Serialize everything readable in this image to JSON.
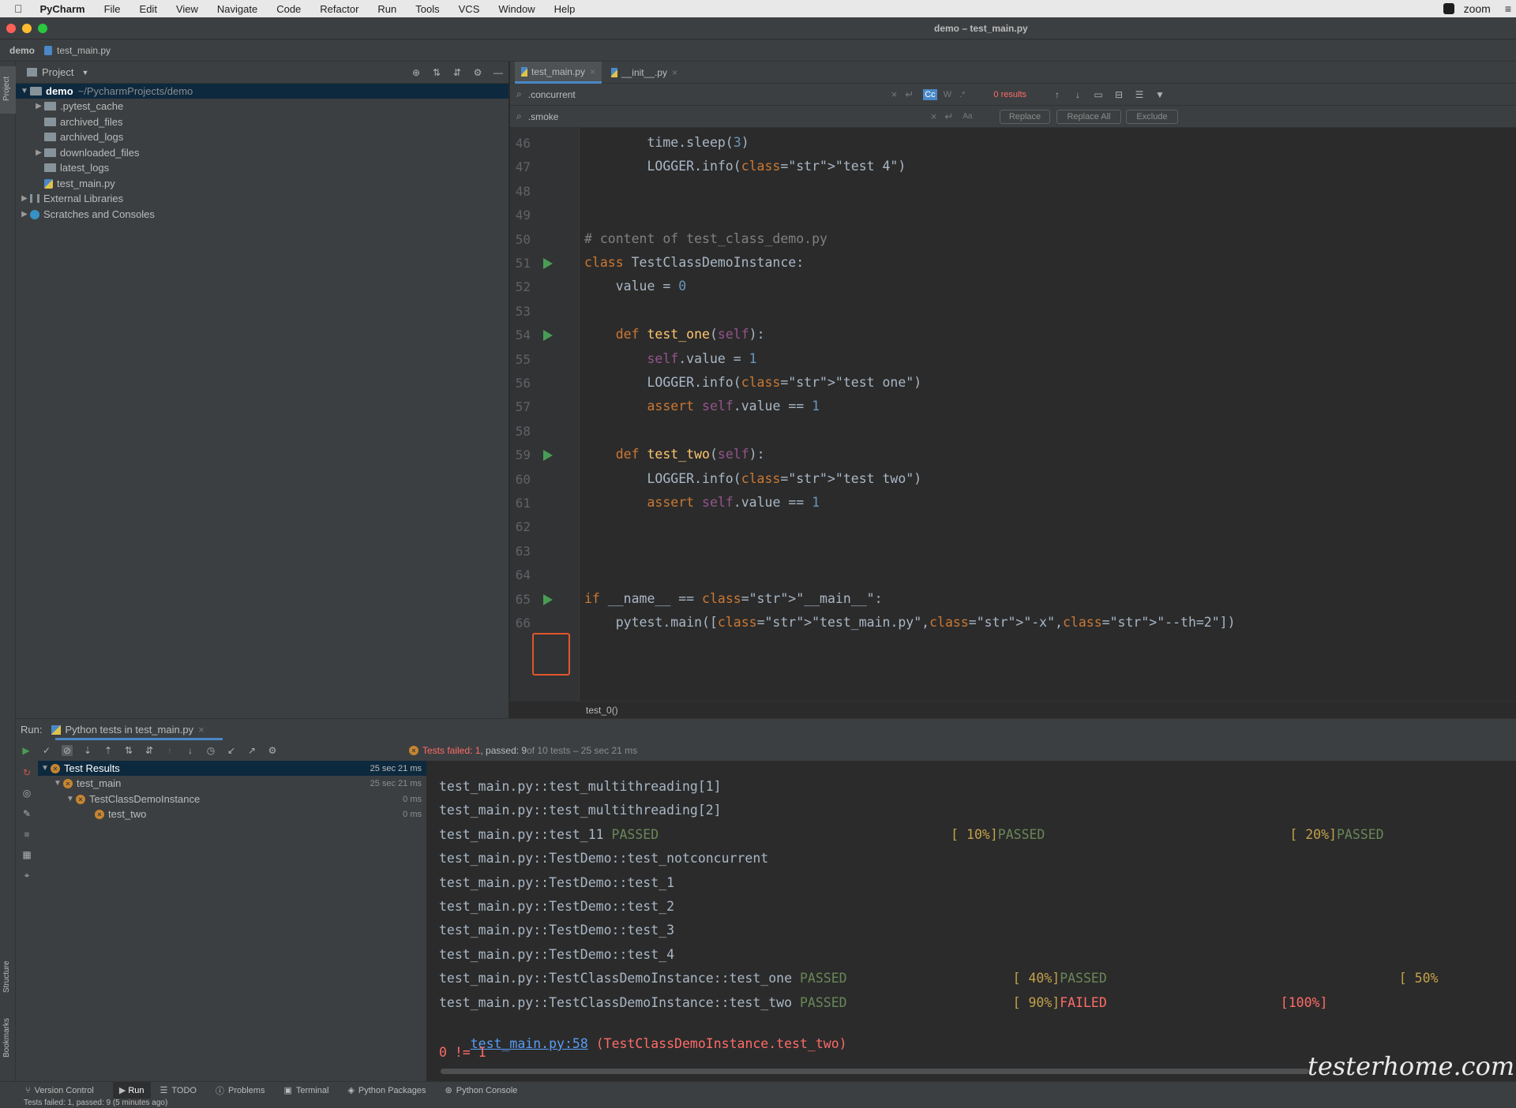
{
  "menubar": {
    "app": "PyCharm",
    "items": [
      "File",
      "Edit",
      "View",
      "Navigate",
      "Code",
      "Refactor",
      "Run",
      "Tools",
      "VCS",
      "Window",
      "Help"
    ],
    "right": "zoom"
  },
  "window": {
    "title": "demo – test_main.py"
  },
  "nav": {
    "project": "demo",
    "file": "test_main.py"
  },
  "project_panel": {
    "title": "Project",
    "tree": [
      {
        "label": "demo",
        "extra": "~/PycharmProjects/demo",
        "depth": 0,
        "type": "folder",
        "expanded": true,
        "selected": true
      },
      {
        "label": ".pytest_cache",
        "depth": 1,
        "type": "folder",
        "collapsed": true
      },
      {
        "label": "archived_files",
        "depth": 1,
        "type": "folder"
      },
      {
        "label": "archived_logs",
        "depth": 1,
        "type": "folder"
      },
      {
        "label": "downloaded_files",
        "depth": 1,
        "type": "folder",
        "collapsed": true
      },
      {
        "label": "latest_logs",
        "depth": 1,
        "type": "folder"
      },
      {
        "label": "test_main.py",
        "depth": 1,
        "type": "python-file"
      },
      {
        "label": "External Libraries",
        "depth": 0,
        "type": "library",
        "collapsed": true
      },
      {
        "label": "Scratches and Consoles",
        "depth": 0,
        "type": "scratch",
        "collapsed": true
      }
    ]
  },
  "editor": {
    "tabs": [
      {
        "label": "test_main.py",
        "active": true
      },
      {
        "label": "__init__.py",
        "active": false
      }
    ],
    "find": {
      "query": ".concurrent",
      "results": "0 results",
      "cc": "Cc",
      "w": "W"
    },
    "replace": {
      "query": ".smoke",
      "replace_label": "Replace",
      "replace_all_label": "Replace All",
      "exclude_label": "Exclude"
    },
    "breadcrumb": "test_0()"
  },
  "code_lines": [
    {
      "n": "46",
      "text": "        time.sleep(3)"
    },
    {
      "n": "47",
      "text": "        LOGGER.info(\"test 4\")"
    },
    {
      "n": "48",
      "text": ""
    },
    {
      "n": "49",
      "text": ""
    },
    {
      "n": "50",
      "text": "# content of test_class_demo.py"
    },
    {
      "n": "51",
      "text": "class TestClassDemoInstance:",
      "run": true
    },
    {
      "n": "52",
      "text": "    value = 0"
    },
    {
      "n": "53",
      "text": ""
    },
    {
      "n": "54",
      "text": "    def test_one(self):",
      "run": true
    },
    {
      "n": "55",
      "text": "        self.value = 1"
    },
    {
      "n": "56",
      "text": "        LOGGER.info(\"test one\")"
    },
    {
      "n": "57",
      "text": "        assert self.value == 1"
    },
    {
      "n": "58",
      "text": ""
    },
    {
      "n": "59",
      "text": "    def test_two(self):",
      "run": true
    },
    {
      "n": "60",
      "text": "        LOGGER.info(\"test two\")"
    },
    {
      "n": "61",
      "text": "        assert self.value == 1"
    },
    {
      "n": "62",
      "text": ""
    },
    {
      "n": "63",
      "text": ""
    },
    {
      "n": "64",
      "text": ""
    },
    {
      "n": "65",
      "text": "if __name__ == \"__main__\":",
      "run": true
    },
    {
      "n": "66",
      "text": "    pytest.main([\"test_main.py\",\"-x\",\"--th=2\"])"
    }
  ],
  "run_panel": {
    "label": "Run:",
    "tab": "Python tests in test_main.py",
    "status": {
      "failed": "Tests failed: 1",
      "passed": ", passed: 9",
      "rest": " of 10 tests – 25 sec 21 ms"
    },
    "tree": [
      {
        "label": "Test Results",
        "time": "25 sec 21 ms",
        "depth": 0
      },
      {
        "label": "test_main",
        "time": "25 sec 21 ms",
        "depth": 1
      },
      {
        "label": "TestClassDemoInstance",
        "time": "0 ms",
        "depth": 2
      },
      {
        "label": "test_two",
        "time": "0 ms",
        "depth": 3
      }
    ]
  },
  "console": {
    "lines": [
      {
        "text": "test_main.py::test_multithreading[1]"
      },
      {
        "text": "test_main.py::test_multithreading[2]"
      },
      {
        "text": "test_main.py::test_11 ",
        "a": "PASSED",
        "b": "[ 10%]",
        "c": "PASSED",
        "d": "[ 20%]",
        "e": "PASSED"
      },
      {
        "text": "test_main.py::TestDemo::test_notconcurrent"
      },
      {
        "text": "test_main.py::TestDemo::test_1"
      },
      {
        "text": "test_main.py::TestDemo::test_2"
      },
      {
        "text": "test_main.py::TestDemo::test_3"
      },
      {
        "text": "test_main.py::TestDemo::test_4"
      },
      {
        "text": "test_main.py::TestClassDemoInstance::test_one ",
        "a": "PASSED",
        "b": "[ 40%]",
        "c": "PASSED",
        "d": "[ 50%"
      },
      {
        "text": "test_main.py::TestClassDemoInstance::test_two ",
        "a": "PASSED",
        "b": "[ 90%]",
        "c": "FAILED",
        "d": "[100%]"
      }
    ],
    "link": "test_main.py:58",
    "link_rest": " (TestClassDemoInstance.test_two)",
    "error": "0 != 1"
  },
  "bottom_tools": [
    "Version Control",
    "Run",
    "TODO",
    "Problems",
    "Terminal",
    "Python Packages",
    "Python Console"
  ],
  "status_bar": "Tests failed: 1, passed: 9 (5 minutes ago)",
  "side_labels": {
    "project": "Project",
    "structure": "Structure",
    "bookmarks": "Bookmarks"
  },
  "watermark": "testerhome.com"
}
